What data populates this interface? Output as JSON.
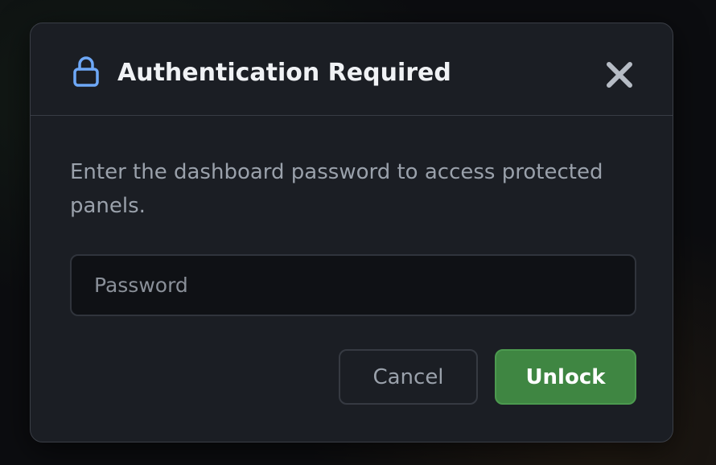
{
  "dialog": {
    "title": "Authentication Required",
    "lock_icon": "lock-icon",
    "close_icon": "close-icon",
    "description": "Enter the dashboard password to access protected panels.",
    "password_input": {
      "value": "",
      "placeholder": "Password"
    },
    "cancel_label": "Cancel",
    "unlock_label": "Unlock"
  },
  "colors": {
    "accent_lock": "#6ea8f7",
    "unlock_button": "#3f8642",
    "modal_background": "#1b1e24"
  }
}
